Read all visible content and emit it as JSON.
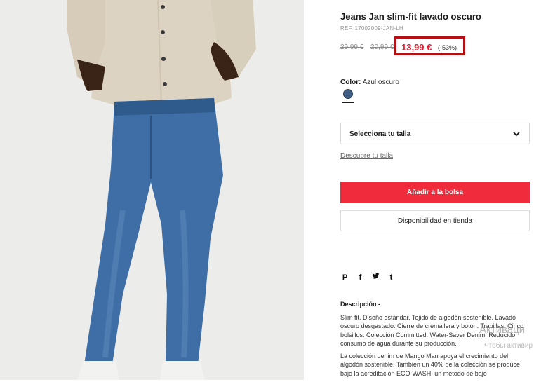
{
  "product": {
    "title": "Jeans Jan slim-fit lavado oscuro",
    "ref": "REF. 17002009-JAN-LH",
    "old_price_1": "29,99 €",
    "old_price_2": "20,99 €",
    "price": "13,99 €",
    "discount": "(-53%)",
    "accent_color": "#e01e2f",
    "highlight_box_color": "#b40f14"
  },
  "color": {
    "label": "Color:",
    "value": "Azul oscuro",
    "swatch_color": "#3d5a80"
  },
  "size": {
    "select_label": "Selecciona tu talla",
    "guide_link": "Descubre tu talla",
    "icon": "chevron-down-icon"
  },
  "actions": {
    "add_to_bag": "Añadir a la bolsa",
    "add_to_bag_color": "#f02b3b",
    "store_availability": "Disponibilidad en tienda"
  },
  "share": {
    "icons": [
      "pinterest-icon",
      "facebook-icon",
      "twitter-icon",
      "tumblr-icon"
    ],
    "glyphs": [
      "P",
      "f",
      "t",
      "t"
    ]
  },
  "description": {
    "title": "Descripción -",
    "paragraph_1": "Slim fit. Diseño estándar. Tejido de algodón sostenible. Lavado oscuro desgastado. Cierre de cremallera y botón. Trabillas. Cinco bolsillos. Colección Committed. Water-Saver Denim: Reducido consumo de agua durante su producción.",
    "paragraph_2": "La colección denim de Mango Man apoya el crecimiento del algodón sostenible. También un 40% de la colección se produce bajo la acreditación ECO-WASH, un método de bajo"
  },
  "overlay": {
    "line_1": "Активаци",
    "line_2": "Чтобы активир"
  }
}
